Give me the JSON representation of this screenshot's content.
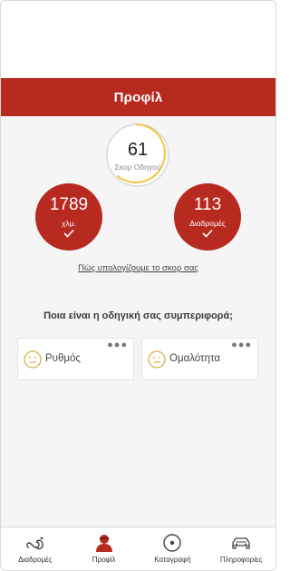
{
  "header": {
    "title": "Προφίλ"
  },
  "score": {
    "value": "61",
    "label": "Σκορ Οδηγού",
    "accent_color": "#f3c445",
    "fraction": 0.61
  },
  "stats": [
    {
      "value": "1789",
      "unit": "χλμ."
    },
    {
      "value": "113",
      "unit": "Διαδρομές"
    }
  ],
  "how_link": "Πώς υπολογίζουμε το σκορ σας",
  "question": "Ποια είναι η οδηγική σας συμπεριφορά;",
  "cards": [
    {
      "label": "Ρυθμός",
      "icon": "neutral-face-icon"
    },
    {
      "label": "Ομαλότητα",
      "icon": "neutral-face-icon"
    }
  ],
  "tabs": [
    {
      "label": "Διαδρομές",
      "icon": "routes-icon"
    },
    {
      "label": "Προφίλ",
      "icon": "user-icon",
      "active": true
    },
    {
      "label": "Καταγραφή",
      "icon": "record-icon"
    },
    {
      "label": "Πληροφορίες",
      "icon": "car-icon"
    }
  ],
  "colors": {
    "brand": "#b72a20",
    "accent": "#f3c445",
    "face": "#e0a93a"
  }
}
